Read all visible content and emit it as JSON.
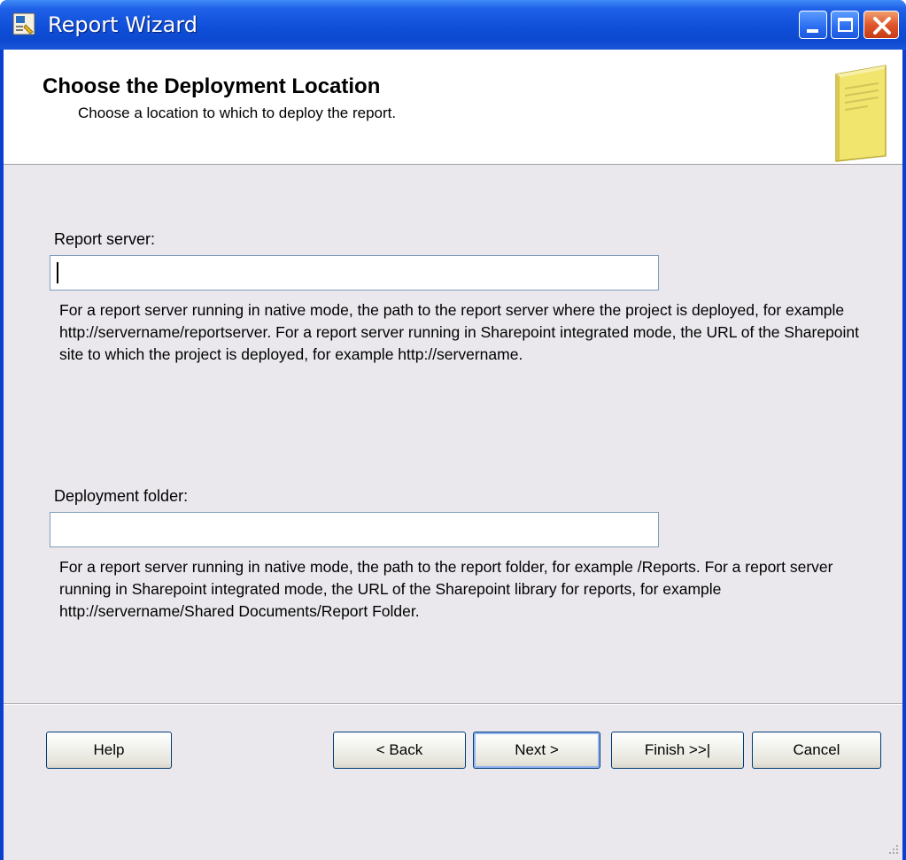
{
  "window": {
    "title": "Report Wizard"
  },
  "header": {
    "title": "Choose the Deployment Location",
    "subtitle": "Choose a location to which to deploy the report."
  },
  "report_server": {
    "label": "Report server:",
    "value": "",
    "help": "For a report server running in native mode, the path to the report server where the project is deployed, for example http://servername/reportserver.  For a report server running in Sharepoint integrated mode, the URL of the Sharepoint site to which the project is deployed, for example http://servername."
  },
  "deployment_folder": {
    "label": "Deployment folder:",
    "value": "",
    "help": "For a report server running in native mode, the path to the report folder, for example /Reports. For a report server running in Sharepoint integrated mode, the URL of the Sharepoint library for reports, for example http://servername/Shared Documents/Report Folder."
  },
  "buttons": {
    "help": "Help",
    "back": "< Back",
    "next": "Next >",
    "finish": "Finish >>|",
    "cancel": "Cancel"
  },
  "icons": {
    "app": "report-wizard-icon",
    "header": "document-icon",
    "minimize": "minimize-icon",
    "maximize": "maximize-icon",
    "close": "close-icon"
  },
  "colors": {
    "titlebar": "#0c49d0",
    "client_bg": "#eae8ed",
    "close_button": "#e0572c"
  }
}
